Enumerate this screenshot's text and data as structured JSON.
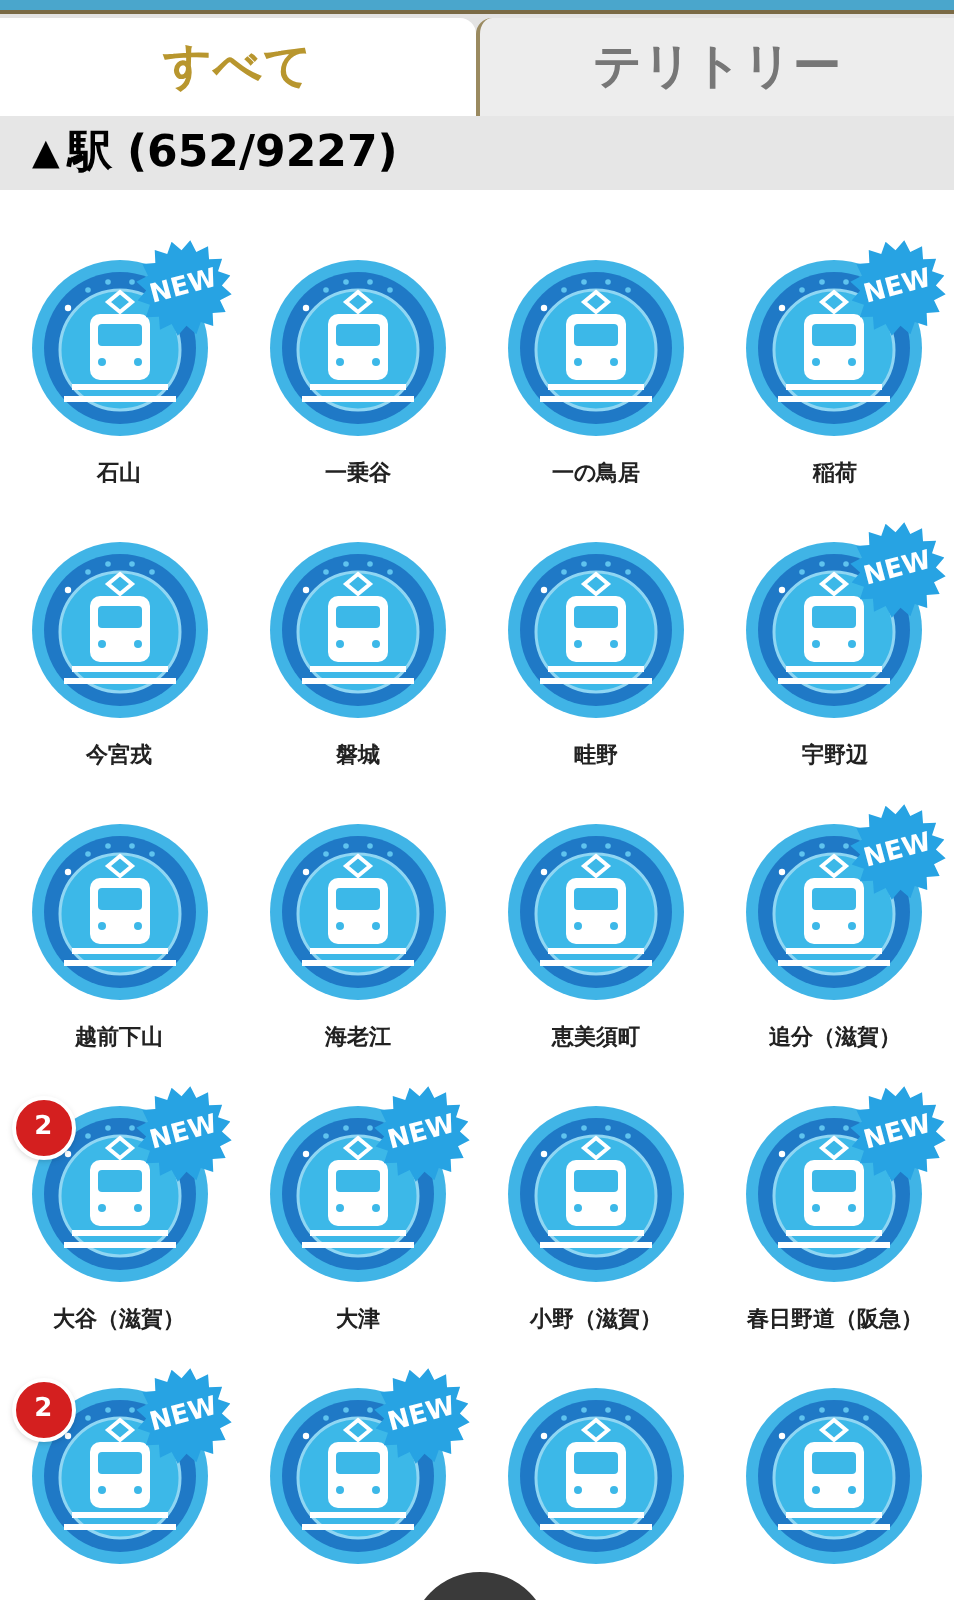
{
  "tabs": [
    {
      "label": "すべて",
      "selected": true
    },
    {
      "label": "テリトリー",
      "selected": false
    }
  ],
  "section": {
    "arrow": "▲",
    "title": "駅 (652/9227)"
  },
  "stations": [
    {
      "kind": "station",
      "name": "石山",
      "new_badge": "NEW"
    },
    {
      "kind": "station",
      "name": "一乗谷"
    },
    {
      "kind": "station",
      "name": "一の鳥居"
    },
    {
      "kind": "station",
      "name": "稲荷",
      "new_badge": "NEW"
    },
    {
      "kind": "station",
      "name": "今宮戎"
    },
    {
      "kind": "station",
      "name": "磐城"
    },
    {
      "kind": "station",
      "name": "畦野"
    },
    {
      "kind": "station",
      "name": "宇野辺",
      "new_badge": "NEW"
    },
    {
      "kind": "station",
      "name": "越前下山"
    },
    {
      "kind": "station",
      "name": "海老江"
    },
    {
      "kind": "station",
      "name": "恵美須町"
    },
    {
      "kind": "station",
      "name": "追分（滋賀）",
      "new_badge": "NEW"
    },
    {
      "kind": "station",
      "name": "大谷（滋賀）",
      "new_badge": "NEW",
      "count": "2"
    },
    {
      "kind": "station",
      "name": "大津",
      "new_badge": "NEW"
    },
    {
      "kind": "station",
      "name": "小野（滋賀）"
    },
    {
      "kind": "station",
      "name": "春日野道（阪急）",
      "new_badge": "NEW"
    },
    {
      "kind": "station",
      "new_badge": "NEW",
      "count": "2"
    },
    {
      "kind": "station",
      "new_badge": "NEW"
    },
    {
      "kind": "station"
    },
    {
      "kind": "station"
    }
  ]
}
